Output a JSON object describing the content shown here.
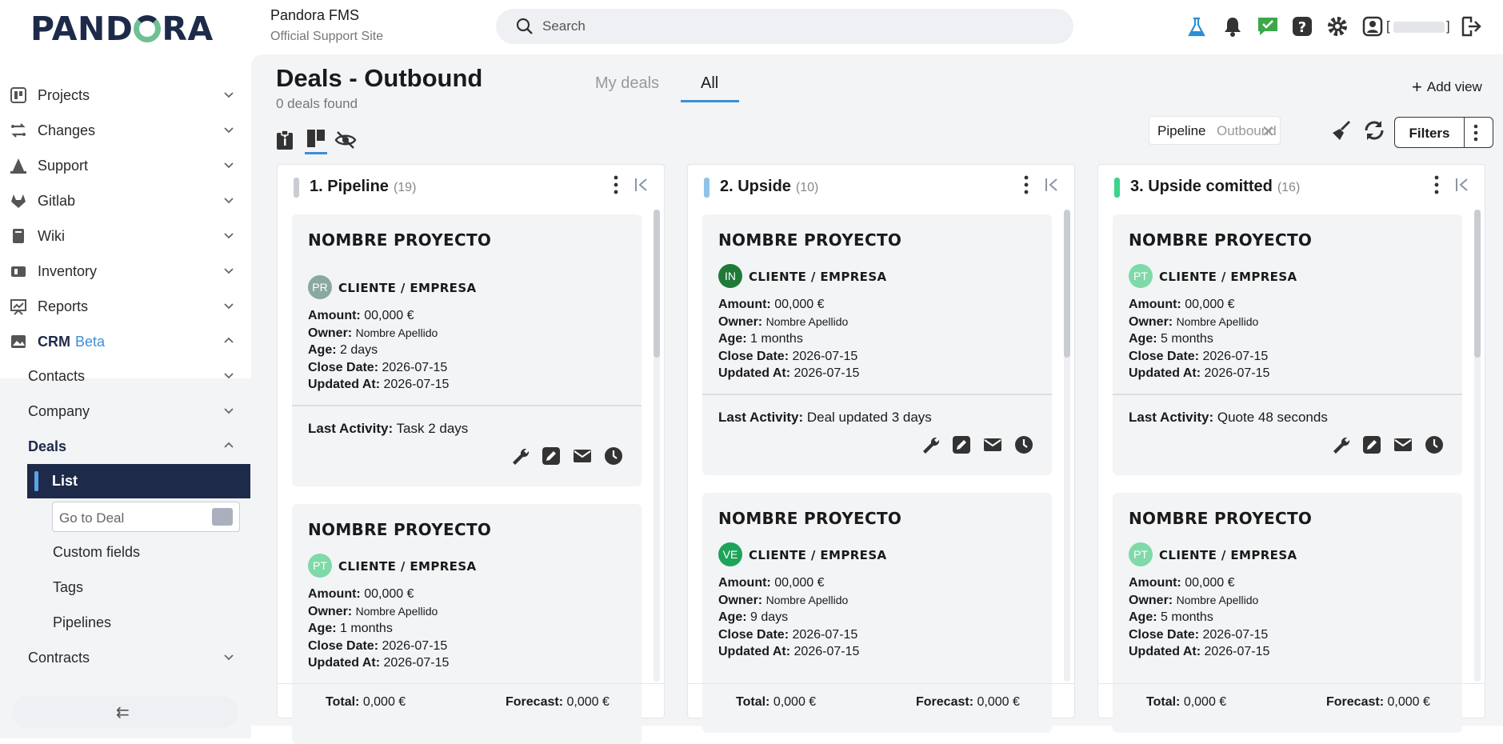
{
  "header": {
    "logo": "PAND",
    "logo_rest": "RA",
    "site_title": "Pandora FMS",
    "site_subtitle": "Official Support Site",
    "search_placeholder": "Search",
    "user_bracket_open": "[",
    "user_bracket_close": "]",
    "icons": [
      "flask-icon",
      "bell-icon",
      "chat-icon",
      "help-icon",
      "gear-icon",
      "user-icon",
      "logout-icon"
    ]
  },
  "sidebar": {
    "items": [
      {
        "label": "Projects",
        "icon": "projects-icon"
      },
      {
        "label": "Changes",
        "icon": "changes-icon"
      },
      {
        "label": "Support",
        "icon": "support-icon"
      },
      {
        "label": "Gitlab",
        "icon": "gitlab-icon"
      },
      {
        "label": "Wiki",
        "icon": "wiki-icon"
      },
      {
        "label": "Inventory",
        "icon": "inventory-icon"
      },
      {
        "label": "Reports",
        "icon": "reports-icon"
      }
    ],
    "crm": {
      "label": "CRM",
      "badge": "Beta"
    },
    "crm_items": [
      "Contacts",
      "Company"
    ],
    "deals": "Deals",
    "deals_list": "List",
    "goto_placeholder": "Go to Deal",
    "deals_sub": [
      "Custom fields",
      "Tags",
      "Pipelines"
    ],
    "contracts": "Contracts"
  },
  "page": {
    "title": "Deals - Outbound",
    "count": "0 deals found",
    "tabs": [
      "My deals",
      "All"
    ],
    "active_tab": "All",
    "add_view": "Add view",
    "filter_chip_key": "Pipeline",
    "filter_chip_value": "Outbound",
    "filters_label": "Filters"
  },
  "columns": [
    {
      "title": "1. Pipeline",
      "count": "(19)",
      "color": "#c9cdd3",
      "total_label": "Total:",
      "total": "0,000 €",
      "forecast_label": "Forecast:",
      "forecast": "0,000 €",
      "cards": [
        {
          "name": "NOMBRE PROYECTO",
          "avatar": "PR",
          "avatar_color": "#8aa8a0",
          "client": "CLIENTE / EMPRESA",
          "amount": "00,000 €",
          "owner": "Nombre Apellido",
          "age": "2 days",
          "close": "2026-07-15",
          "updated": "2026-07-15",
          "activity": "Task 2 days"
        },
        {
          "name": "NOMBRE PROYECTO",
          "avatar": "PT",
          "avatar_color": "#7fd9a8",
          "client": "CLIENTE / EMPRESA",
          "amount": "00,000 €",
          "owner": "Nombre Apellido",
          "age": "1 months",
          "close": "2026-07-15",
          "updated": "2026-07-15"
        }
      ]
    },
    {
      "title": "2. Upside",
      "count": "(10)",
      "color": "#8fc3ea",
      "total_label": "Total:",
      "total": "0,000 €",
      "forecast_label": "Forecast:",
      "forecast": "0,000 €",
      "cards": [
        {
          "name": "NOMBRE PROYECTO",
          "avatar": "IN",
          "avatar_color": "#1f7a3a",
          "client": "CLIENTE / EMPRESA",
          "amount": "00,000 €",
          "owner": "Nombre Apellido",
          "age": "1 months",
          "close": "2026-07-15",
          "updated": "2026-07-15",
          "activity": "Deal updated 3 days"
        },
        {
          "name": "NOMBRE PROYECTO",
          "avatar": "VE",
          "avatar_color": "#1fa35a",
          "client": "CLIENTE / EMPRESA",
          "amount": "00,000 €",
          "owner": "Nombre Apellido",
          "age": "9 days",
          "close": "2026-07-15",
          "updated": "2026-07-15"
        }
      ]
    },
    {
      "title": "3. Upside comitted",
      "count": "(16)",
      "color": "#3cd48a",
      "total_label": "Total:",
      "total": "0,000 €",
      "forecast_label": "Forecast:",
      "forecast": "0,000 €",
      "cards": [
        {
          "name": "NOMBRE PROYECTO",
          "avatar": "PT",
          "avatar_color": "#7fd9a8",
          "client": "CLIENTE / EMPRESA",
          "amount": "00,000 €",
          "owner": "Nombre Apellido",
          "age": "5 months",
          "close": "2026-07-15",
          "updated": "2026-07-15",
          "activity": "Quote 48 seconds"
        },
        {
          "name": "NOMBRE PROYECTO",
          "avatar": "PT",
          "avatar_color": "#7fd9a8",
          "client": "CLIENTE / EMPRESA",
          "amount": "00,000 €",
          "owner": "Nombre Apellido",
          "age": "5 months",
          "close": "2026-07-15",
          "updated": "2026-07-15"
        }
      ]
    }
  ],
  "labels": {
    "amount": "Amount:",
    "owner": "Owner:",
    "age": "Age:",
    "close": "Close Date:",
    "updated": "Updated At:",
    "last_activity": "Last Activity:"
  }
}
